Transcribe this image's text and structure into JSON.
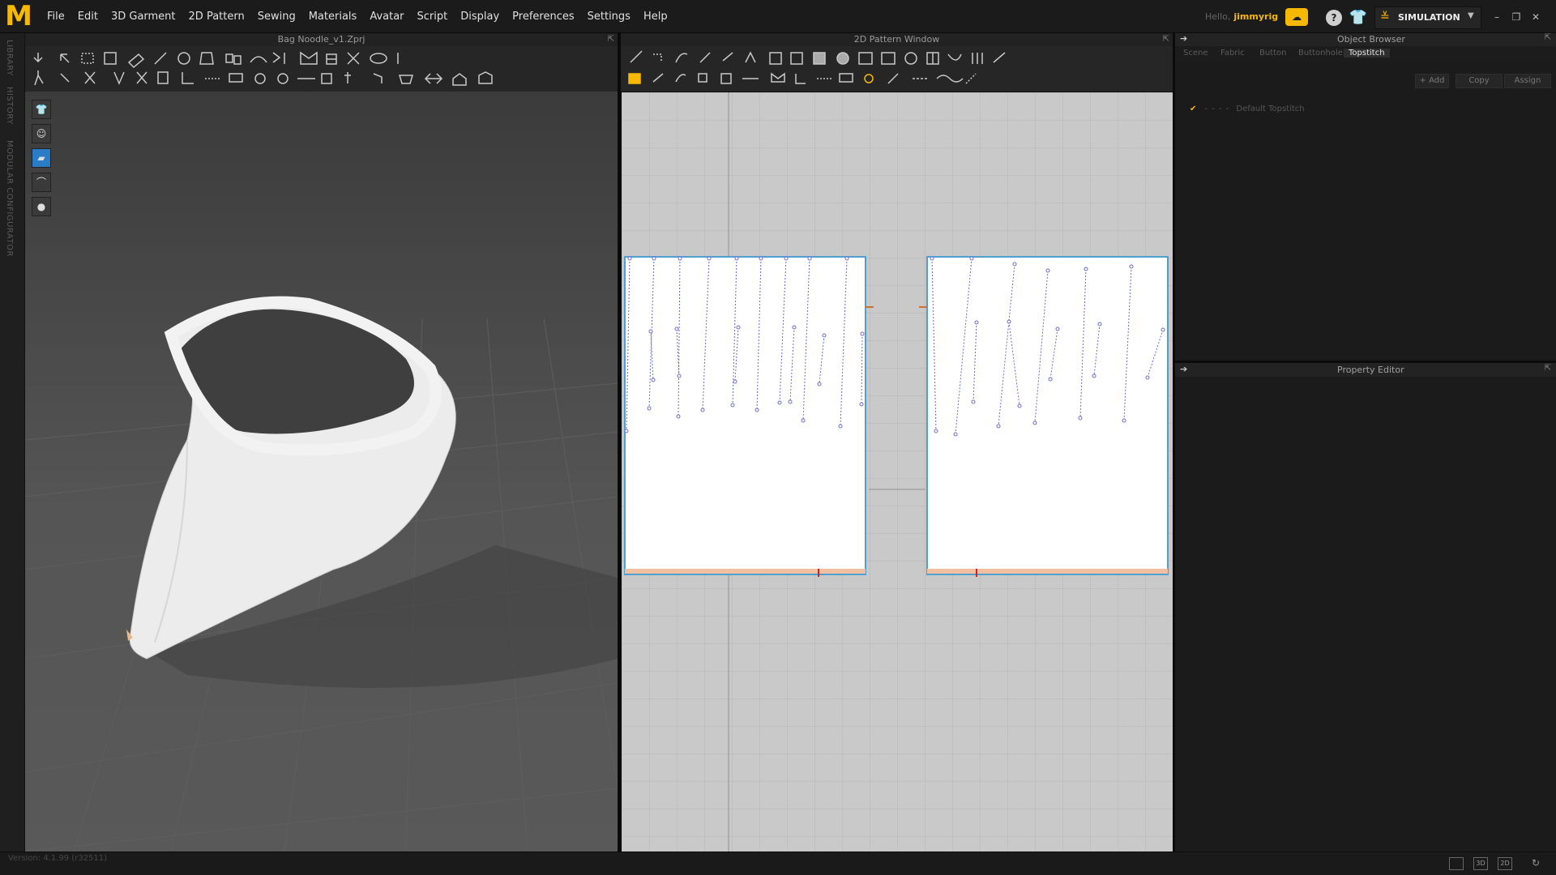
{
  "app": {
    "logo_letter": "M",
    "accent": "#f6b800"
  },
  "menu": [
    "File",
    "Edit",
    "3D Garment",
    "2D Pattern",
    "Sewing",
    "Materials",
    "Avatar",
    "Script",
    "Display",
    "Preferences",
    "Settings",
    "Help"
  ],
  "header": {
    "hello": "Hello,",
    "username": "jimmyrig",
    "mode": "SIMULATION"
  },
  "left_strip": {
    "library": "LIBRARY",
    "history": "HISTORY",
    "modular": "MODULAR CONFIGURATOR"
  },
  "panel_3d": {
    "title": "Bag Noodle_v1.Zprj"
  },
  "panel_2d": {
    "title": "2D Pattern Window"
  },
  "object_browser": {
    "title": "Object Browser",
    "tabs": [
      "Scene",
      "Fabric",
      "Button",
      "Buttonhole",
      "Topstitch"
    ],
    "active_tab": "Topstitch",
    "buttons": {
      "add": "+ Add",
      "copy": "Copy",
      "assign": "Assign"
    },
    "items": [
      {
        "label": "Default Topstitch"
      }
    ]
  },
  "property_editor": {
    "title": "Property Editor"
  },
  "status": {
    "version": "Version: 4.1.99 (r32511)",
    "view_buttons": [
      "",
      "3D",
      "2D"
    ]
  }
}
